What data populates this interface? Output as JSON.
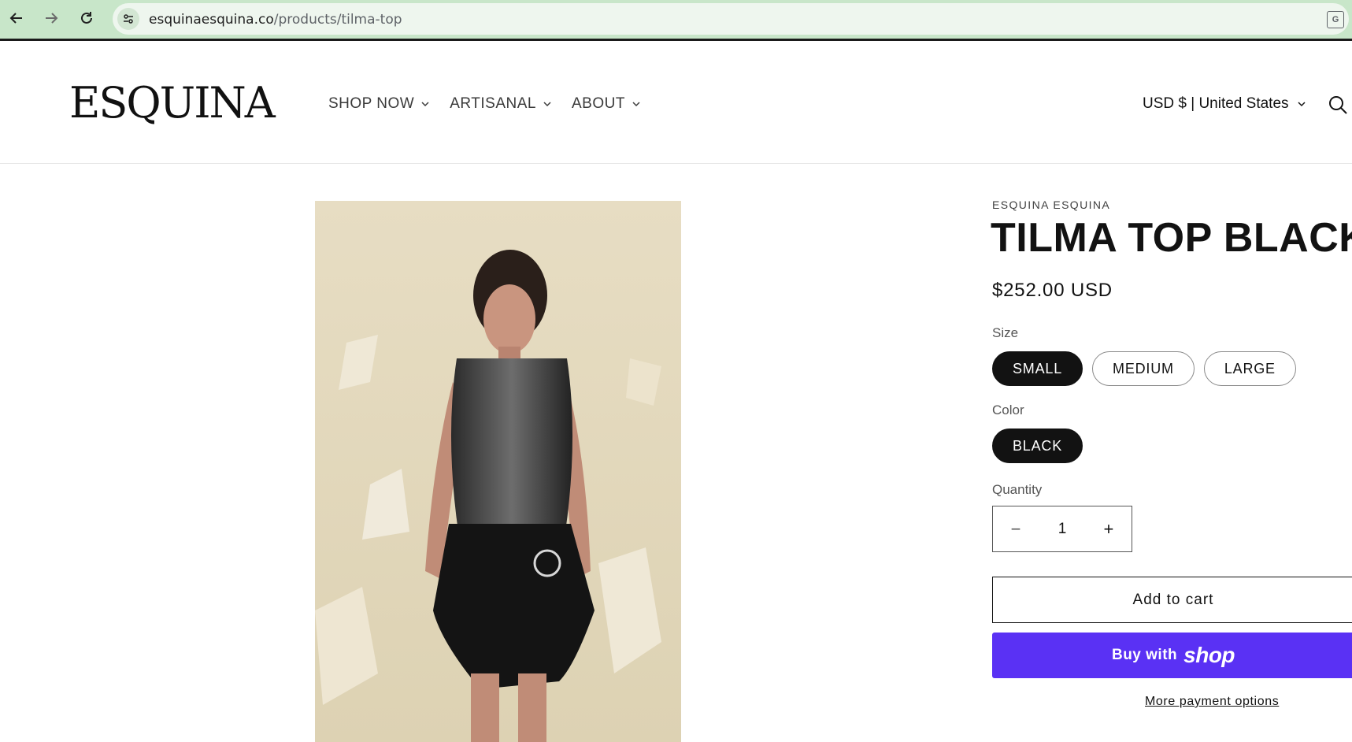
{
  "browser": {
    "url_host": "esquinaesquina.co",
    "url_path": "/products/tilma-top",
    "back_icon": "arrow-left-icon",
    "forward_icon": "arrow-right-icon",
    "reload_icon": "reload-icon",
    "translate_icon": "translate-icon"
  },
  "header": {
    "logo": "ESQUINA",
    "menu": [
      {
        "label": "SHOP NOW"
      },
      {
        "label": "ARTISANAL"
      },
      {
        "label": "ABOUT"
      }
    ],
    "currency": "USD $ | United States",
    "search_icon": "search-icon"
  },
  "product": {
    "vendor": "ESQUINA ESQUINA",
    "title": "TILMA TOP BLACK",
    "price": "$252.00 USD",
    "size_label": "Size",
    "sizes": [
      "SMALL",
      "MEDIUM",
      "LARGE"
    ],
    "selected_size": "SMALL",
    "color_label": "Color",
    "colors": [
      "BLACK"
    ],
    "selected_color": "BLACK",
    "quantity_label": "Quantity",
    "quantity": "1",
    "minus": "−",
    "plus": "+",
    "add_to_cart": "Add to cart",
    "buy_with": "Buy with",
    "shop_brand": "shop",
    "more_payment": "More payment options"
  },
  "colors": {
    "chrome_bg": "#c8e6c9",
    "shop_pay": "#5a31f4",
    "text": "#121212"
  }
}
